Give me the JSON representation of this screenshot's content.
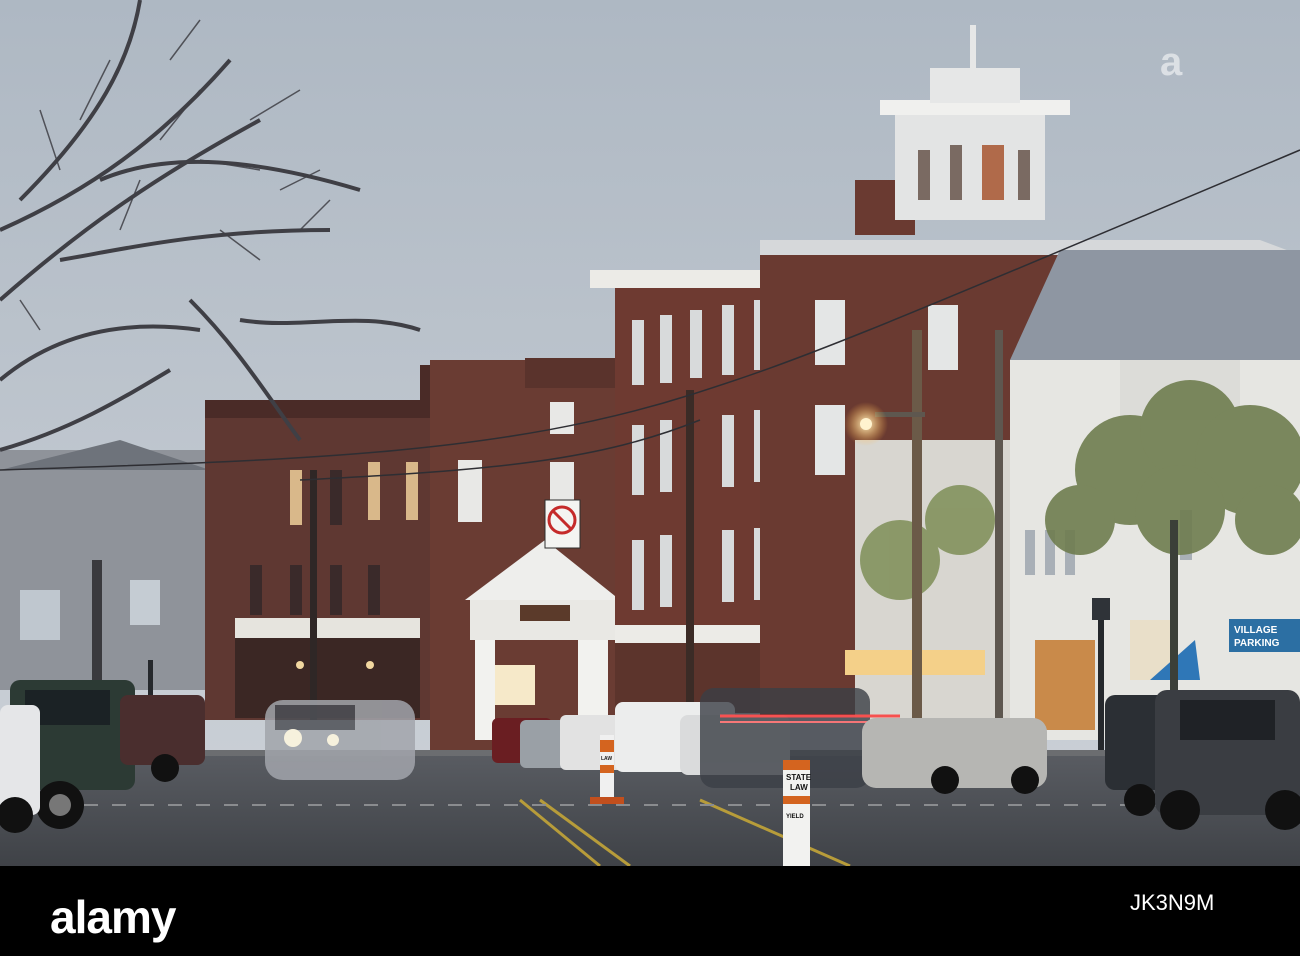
{
  "watermark": "a",
  "footer": {
    "brand": "alamy",
    "image_id": "JK3N9M"
  },
  "signs": {
    "village_parking_line1": "VILLAGE",
    "village_parking_line2": "PARKING",
    "state_law_line1": "STATE",
    "state_law_line2": "LAW",
    "state_law_small": "YIELD",
    "cone_label": "LAW"
  },
  "colors": {
    "sky": "#b9c2cc",
    "brick": "#6b3b33",
    "road": "#4b4e54",
    "sign_blue": "#2c6fa3"
  }
}
